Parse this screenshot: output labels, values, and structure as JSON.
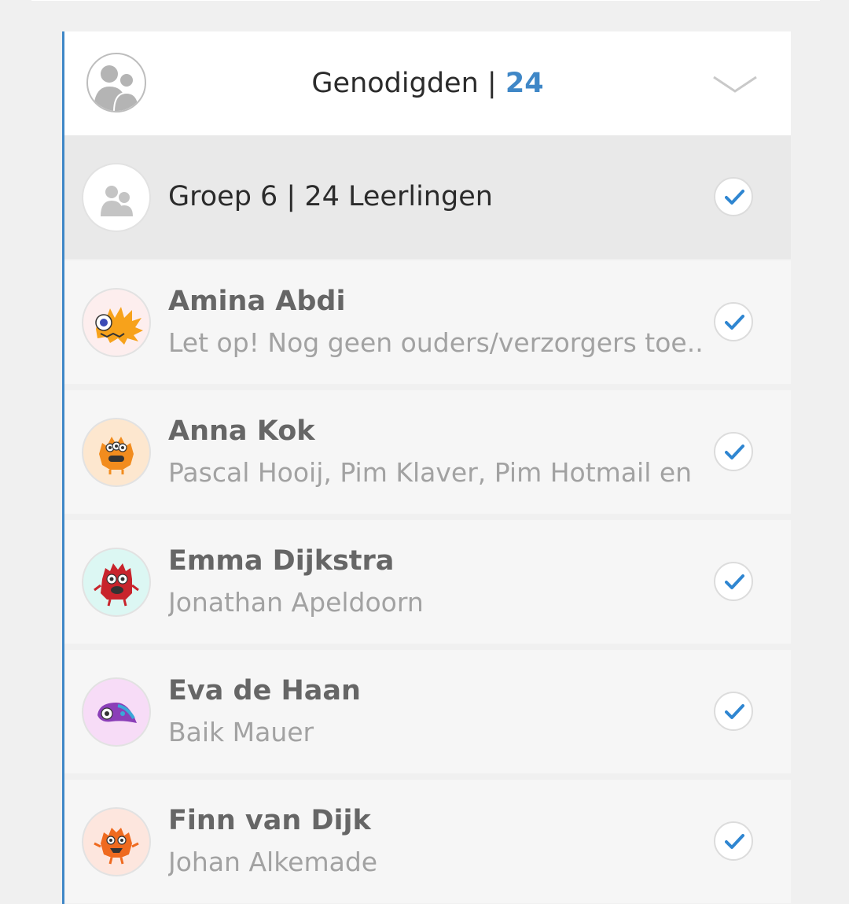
{
  "header": {
    "title": "Genodigden",
    "separator": "|",
    "count": "24",
    "avatar_icon": "group-users-icon",
    "toggle_icon": "chevron-down-icon"
  },
  "group": {
    "label": "Groep 6 | 24 Leerlingen",
    "checked": true,
    "icon": "group-users-icon"
  },
  "students": [
    {
      "name": "Amina Abdi",
      "subtitle": "Let op! Nog geen ouders/verzorgers toe...",
      "checked": true,
      "avatar": "orange-spiky-monster-avatar",
      "avatar_bg": "#fdeeee"
    },
    {
      "name": "Anna Kok",
      "subtitle": "Pascal Hooij, Pim Klaver, Pim Hotmail en ...",
      "checked": true,
      "avatar": "orange-fuzzy-monster-avatar",
      "avatar_bg": "#fde7cf"
    },
    {
      "name": "Emma Dijkstra",
      "subtitle": "Jonathan Apeldoorn",
      "checked": true,
      "avatar": "red-fuzzy-monster-avatar",
      "avatar_bg": "#dcf7f3"
    },
    {
      "name": "Eva de Haan",
      "subtitle": "Baik Mauer",
      "checked": true,
      "avatar": "purple-blob-monster-avatar",
      "avatar_bg": "#f7dcf7"
    },
    {
      "name": "Finn van Dijk",
      "subtitle": "Johan Alkemade",
      "checked": true,
      "avatar": "orange-horned-monster-avatar",
      "avatar_bg": "#fde6de"
    }
  ],
  "colors": {
    "accent": "#3f87c7",
    "text_dark": "#2b2b2b",
    "text_name": "#666666",
    "text_sub": "#a2a2a2"
  }
}
